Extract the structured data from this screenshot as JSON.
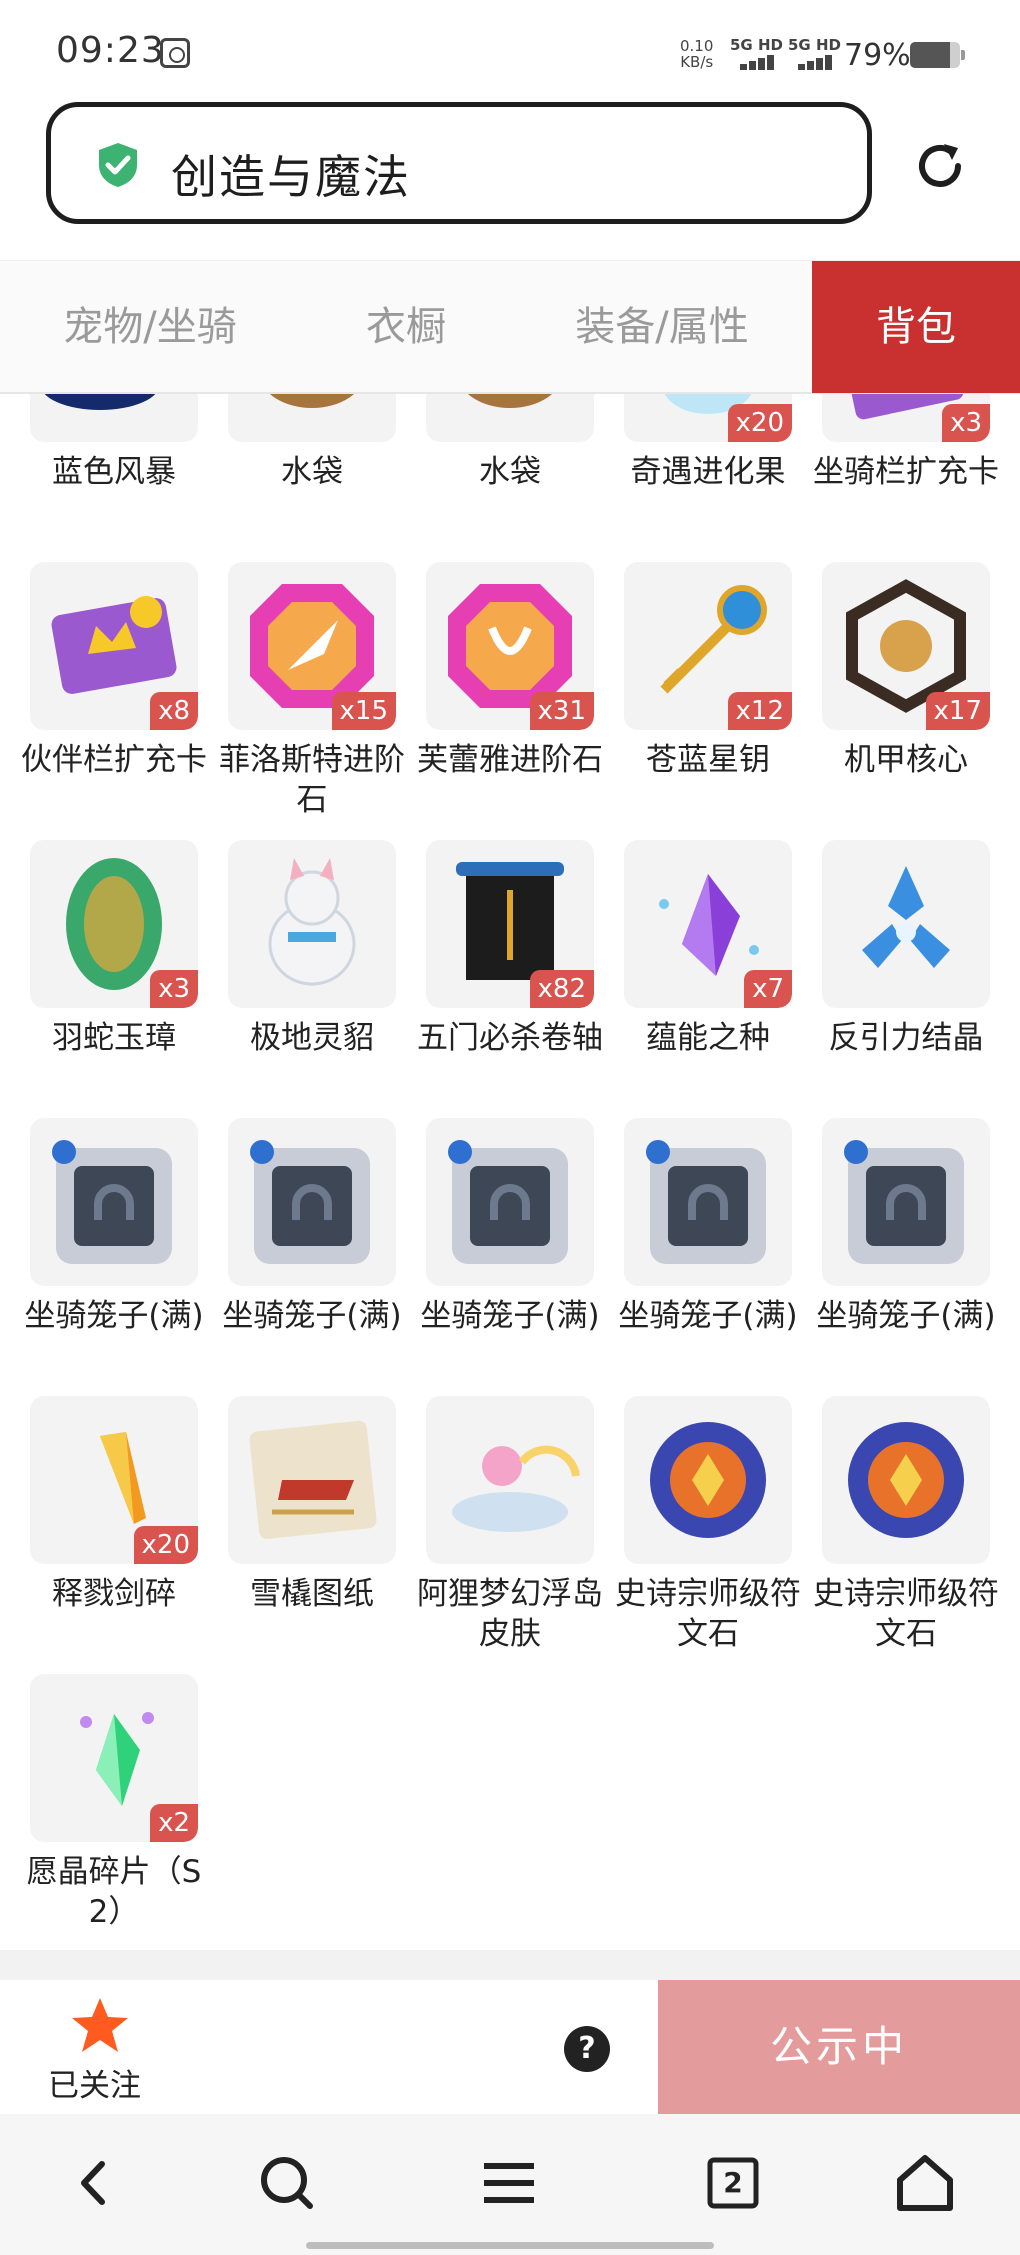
{
  "status_bar": {
    "time": "09:23",
    "net_speed_value": "0.10",
    "net_speed_unit": "KB/s",
    "signal_1": "5G HD",
    "signal_2": "5G HD",
    "battery": "79%",
    "battery_level": 0.79
  },
  "address_bar": {
    "title": "创造与魔法",
    "secure_icon": "shield-check-icon",
    "reload_icon": "reload-icon",
    "accent": "#3cb371"
  },
  "tabs": [
    {
      "label": "宠物/坐骑",
      "active": false
    },
    {
      "label": "衣橱",
      "active": false
    },
    {
      "label": "装备/属性",
      "active": false
    },
    {
      "label": "背包",
      "active": true
    }
  ],
  "items_partial": [
    {
      "name": "蓝色风暴",
      "count": ""
    },
    {
      "name": "水袋",
      "count": ""
    },
    {
      "name": "水袋",
      "count": ""
    },
    {
      "name": "奇遇进化果",
      "count": "x20"
    },
    {
      "name": "坐骑栏扩充卡",
      "count": "x3"
    }
  ],
  "items": [
    {
      "name": "伙伴栏扩充卡",
      "count": "x8",
      "icon": "card-icon"
    },
    {
      "name": "菲洛斯特进阶石",
      "count": "x15",
      "icon": "gem-icon"
    },
    {
      "name": "芙蕾雅进阶石",
      "count": "x31",
      "icon": "gem-icon"
    },
    {
      "name": "苍蓝星钥",
      "count": "x12",
      "icon": "key-icon"
    },
    {
      "name": "机甲核心",
      "count": "x17",
      "icon": "core-icon"
    },
    {
      "name": "羽蛇玉璋",
      "count": "x3",
      "icon": "jade-icon"
    },
    {
      "name": "极地灵貂",
      "count": "",
      "icon": "pet-icon"
    },
    {
      "name": "五门必杀卷轴",
      "count": "x82",
      "icon": "scroll-icon"
    },
    {
      "name": "蕴能之种",
      "count": "x7",
      "icon": "crystal-icon"
    },
    {
      "name": "反引力结晶",
      "count": "",
      "icon": "crystal-emblem-icon"
    },
    {
      "name": "坐骑笼子(满)",
      "count": "",
      "icon": "cage-icon"
    },
    {
      "name": "坐骑笼子(满)",
      "count": "",
      "icon": "cage-icon"
    },
    {
      "name": "坐骑笼子(满)",
      "count": "",
      "icon": "cage-icon"
    },
    {
      "name": "坐骑笼子(满)",
      "count": "",
      "icon": "cage-icon"
    },
    {
      "name": "坐骑笼子(满)",
      "count": "",
      "icon": "cage-icon"
    },
    {
      "name": "释戮剑碎",
      "count": "x20",
      "icon": "shard-icon"
    },
    {
      "name": "雪橇图纸",
      "count": "",
      "icon": "blueprint-icon"
    },
    {
      "name": "阿狸梦幻浮岛皮肤",
      "count": "",
      "icon": "island-icon"
    },
    {
      "name": "史诗宗师级符文石",
      "count": "",
      "icon": "rune-icon"
    },
    {
      "name": "史诗宗师级符文石",
      "count": "",
      "icon": "rune-icon"
    },
    {
      "name": "愿晶碎片（S2）",
      "count": "x2",
      "icon": "shard-icon"
    }
  ],
  "action_bar": {
    "favorite_label": "已关注",
    "favorite_icon": "star-icon",
    "help_icon": "question-icon",
    "help_symbol": "?",
    "notice_label": "公示中",
    "notice_color": "#e39b9b",
    "star_color": "#ff5a1f"
  },
  "nav": {
    "back_icon": "back-icon",
    "search_icon": "search-icon",
    "menu_icon": "menu-icon",
    "tabs_count": "2",
    "home_icon": "home-icon"
  }
}
